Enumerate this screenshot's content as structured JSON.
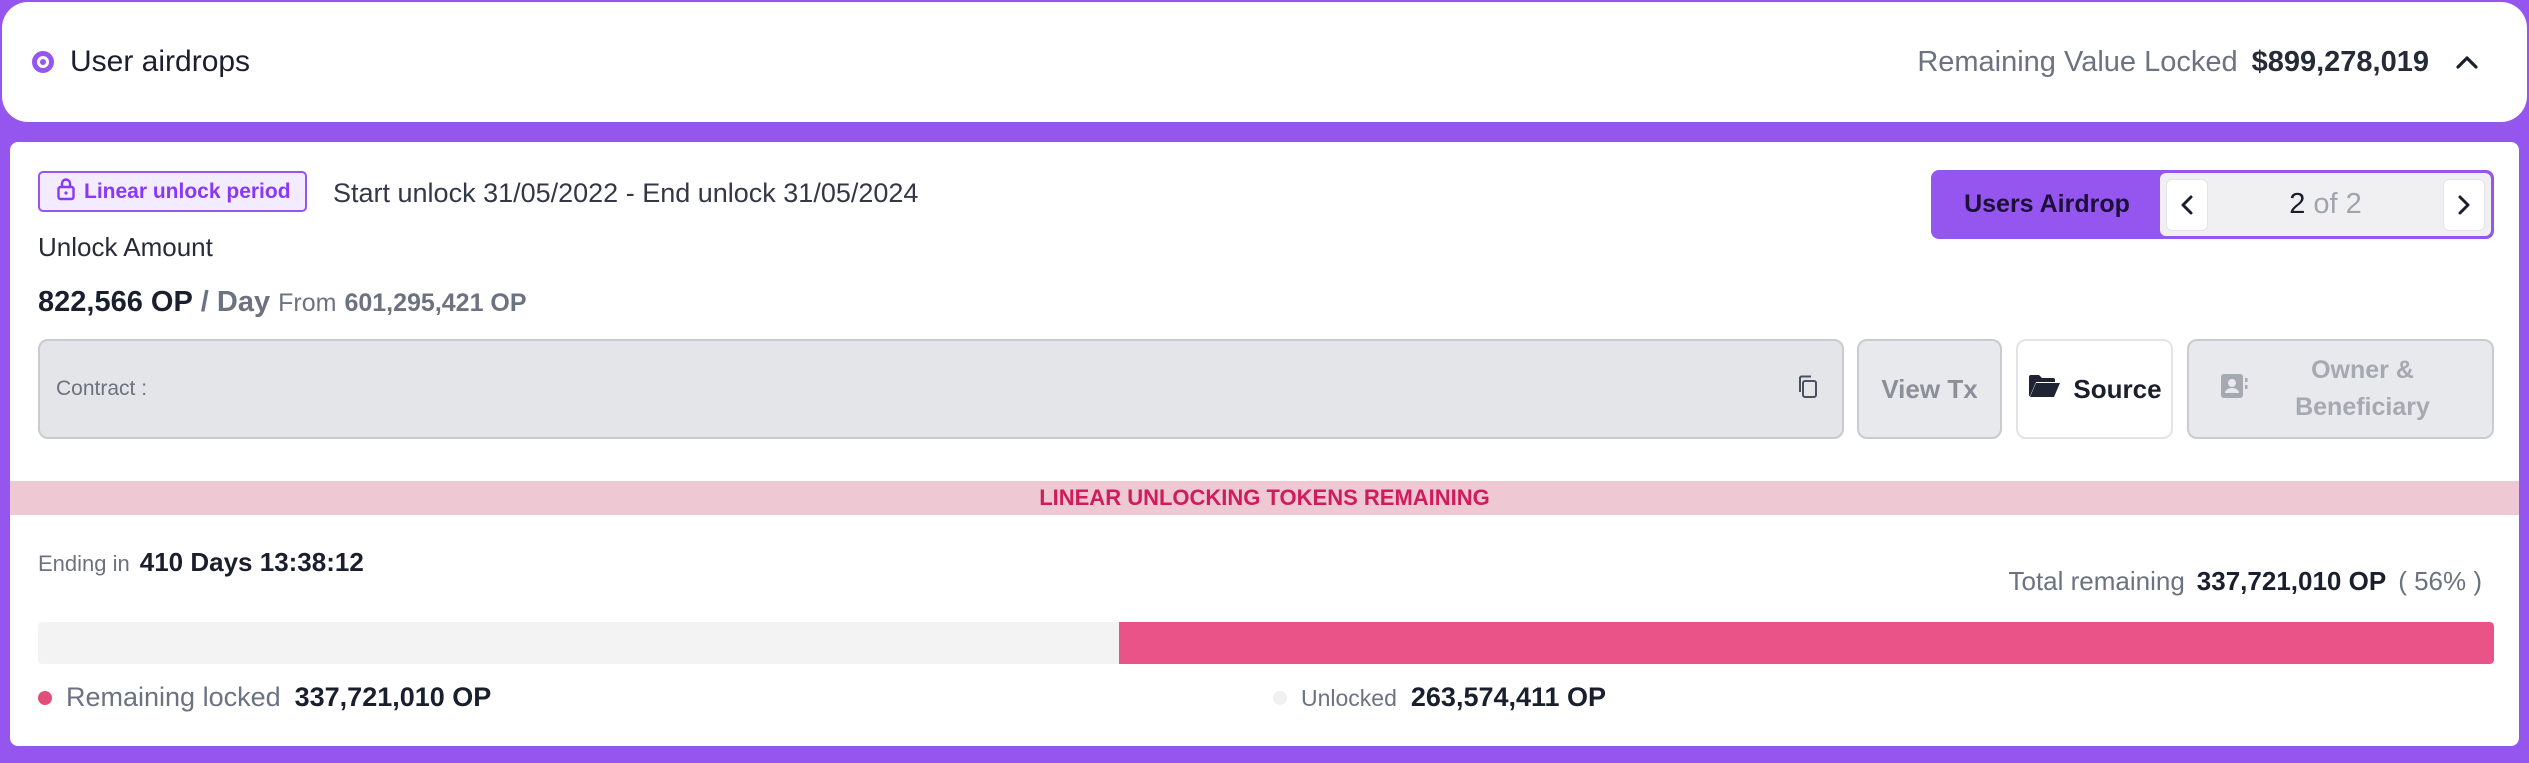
{
  "header": {
    "title": "User airdrops",
    "rvl_label": "Remaining Value Locked",
    "rvl_value": "$899,278,019"
  },
  "badge": {
    "label": "Linear unlock period",
    "icon": "lock-icon"
  },
  "unlock_range": "Start unlock 31/05/2022 - End unlock 31/05/2024",
  "unlock_amount_label": "Unlock Amount",
  "rate": {
    "amount": "822,566 OP",
    "per": "/ Day",
    "from_label": "From",
    "from_amount": "601,295,421 OP"
  },
  "airdrop_control": {
    "label": "Users Airdrop",
    "current": "2",
    "of_text": "of 2"
  },
  "contract": {
    "label": "Contract :",
    "value": ""
  },
  "buttons": {
    "view_tx": "View Tx",
    "source": "Source",
    "owner_line1": "Owner &",
    "owner_line2": "Beneficiary"
  },
  "banner": "LINEAR UNLOCKING TOKENS REMAINING",
  "ending": {
    "label": "Ending in",
    "value": "410 Days 13:38:12"
  },
  "total": {
    "label": "Total remaining",
    "value": "337,721,010 OP",
    "percent": "( 56% )"
  },
  "progress": {
    "remaining_fraction": 0.56,
    "remaining_color": "#ea5387",
    "track_color": "#f3f3f4"
  },
  "legend": {
    "remaining_label": "Remaining locked",
    "remaining_value": "337,721,010 OP",
    "remaining_color": "#e44d7b",
    "unlocked_label": "Unlocked",
    "unlocked_value": "263,574,411 OP",
    "unlocked_color": "#f0f0f2"
  },
  "colors": {
    "accent": "#9556ef",
    "danger": "#d11c5b"
  }
}
